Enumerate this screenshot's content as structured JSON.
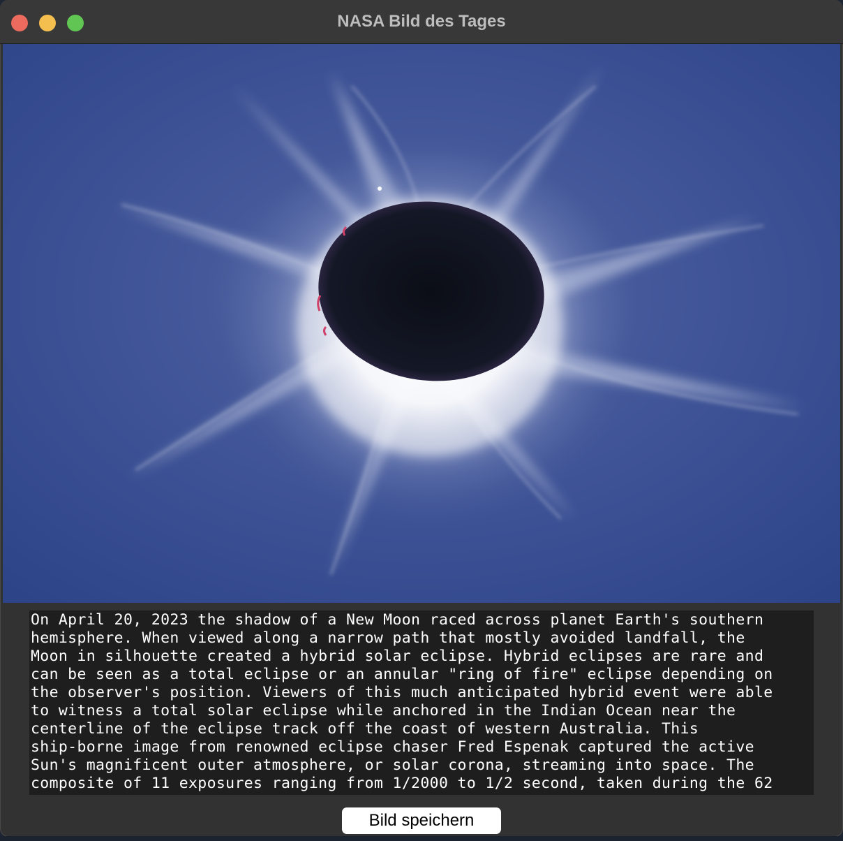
{
  "window": {
    "title": "NASA Bild des Tages"
  },
  "image": {
    "subject": "eclipse-photo",
    "colors": {
      "sky": "#33498a",
      "corona": "#ffffff",
      "moon": "#0d1018",
      "prominence": "#d0416a"
    }
  },
  "description": {
    "lines": [
      "On April 20, 2023 the shadow of a New Moon raced across planet Earth's southern",
      "hemisphere. When viewed along a narrow path that mostly avoided landfall, the",
      "Moon in silhouette created a hybrid solar eclipse. Hybrid eclipses are rare and",
      "can be seen as a total eclipse or an annular \"ring of fire\" eclipse depending on",
      "the observer's position. Viewers of this much anticipated hybrid event were able",
      "to witness a total solar eclipse while anchored in the Indian Ocean near the",
      "centerline of the eclipse track off the coast of western Australia. This",
      "ship-borne image from renowned eclipse chaser Fred Espenak captured the active",
      "Sun's magnificent outer atmosphere, or solar corona, streaming into space. The",
      "composite of 11 exposures ranging from 1/2000 to 1/2 second, taken during the 62"
    ]
  },
  "buttons": {
    "save_label": "Bild speichern"
  }
}
